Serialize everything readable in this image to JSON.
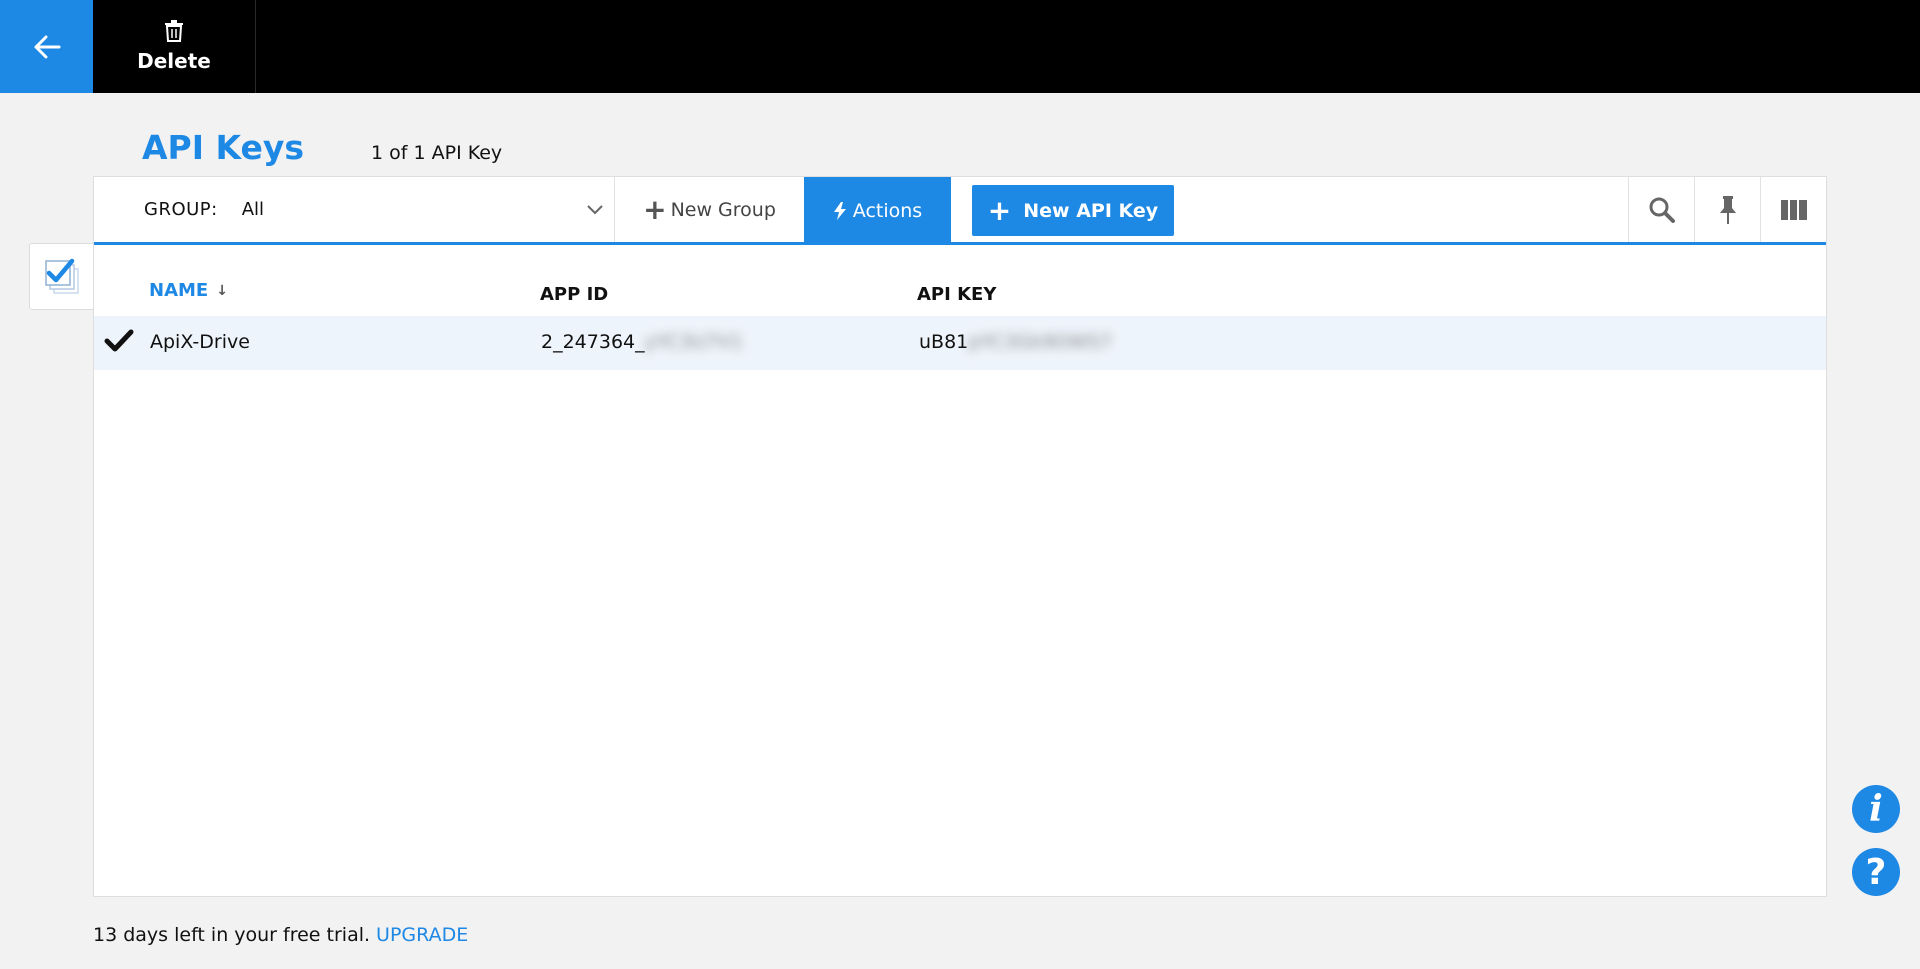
{
  "topbar": {
    "back_icon": "arrow-left-icon",
    "delete_label": "Delete",
    "delete_icon": "trash-icon"
  },
  "page": {
    "title": "API Keys",
    "record_count": "1 of 1 API Key"
  },
  "toolbar": {
    "group_label": "GROUP:",
    "group_value": "All",
    "new_group_label": "New Group",
    "actions_label": "Actions",
    "new_api_key_label": "New API Key"
  },
  "table": {
    "columns": [
      "NAME",
      "APP ID",
      "API KEY"
    ],
    "sort_indicator": "↓",
    "rows": [
      {
        "selected": true,
        "name": "ApiX-Drive",
        "app_id_visible": "2_247364_",
        "app_id_blurred": "yYC3U7V1",
        "api_key_visible": "uB81",
        "api_key_blurred": "pYC3Gk9OWS7"
      }
    ]
  },
  "footer": {
    "trial_text": "13 days left in your free trial.",
    "upgrade_label": "UPGRADE"
  },
  "colors": {
    "accent": "#1e88e5",
    "topbar": "#000000",
    "row_selected": "#eef4fb"
  }
}
